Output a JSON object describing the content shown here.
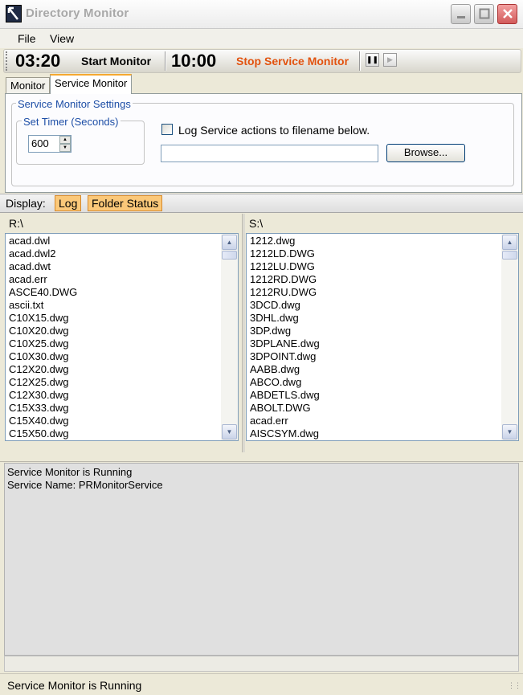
{
  "window": {
    "title": "Directory Monitor"
  },
  "menu": {
    "file": "File",
    "view": "View"
  },
  "toolbar": {
    "start_time": "03:20",
    "start_label": "Start Monitor",
    "stop_time": "10:00",
    "stop_label": "Stop Service Monitor",
    "stop_color": "#e2520f"
  },
  "tabs": [
    {
      "label": "Monitor",
      "active": false
    },
    {
      "label": "Service Monitor",
      "active": true
    }
  ],
  "settings": {
    "group_label": "Service Monitor Settings",
    "timer_group_label": "Set Timer (Seconds)",
    "timer_value": "600",
    "log_checkbox_label": "Log Service actions to filename below.",
    "log_checked": false,
    "filename_value": "",
    "browse_label": "Browse..."
  },
  "display": {
    "label": "Display:",
    "log_button": "Log",
    "folder_status_button": "Folder Status"
  },
  "left_pane": {
    "header": "R:\\",
    "items": [
      "acad.dwl",
      "acad.dwl2",
      "acad.dwt",
      "acad.err",
      "ASCE40.DWG",
      "ascii.txt",
      "C10X15.dwg",
      "C10X20.dwg",
      "C10X25.dwg",
      "C10X30.dwg",
      "C12X20.dwg",
      "C12X25.dwg",
      "C12X30.dwg",
      "C15X33.dwg",
      "C15X40.dwg",
      "C15X50.dwg"
    ]
  },
  "right_pane": {
    "header": "S:\\",
    "items": [
      "1212.dwg",
      "1212LD.DWG",
      "1212LU.DWG",
      "1212RD.DWG",
      "1212RU.DWG",
      "3DCD.dwg",
      "3DHL.dwg",
      "3DP.dwg",
      "3DPLANE.dwg",
      "3DPOINT.dwg",
      "AABB.dwg",
      "ABCO.dwg",
      "ABDETLS.dwg",
      "ABOLT.DWG",
      "acad.err",
      "AISCSYM.dwg"
    ]
  },
  "log": {
    "lines": [
      "Service Monitor is Running",
      "Service Name: PRMonitorService"
    ]
  },
  "status": {
    "text": "Service Monitor is Running"
  }
}
